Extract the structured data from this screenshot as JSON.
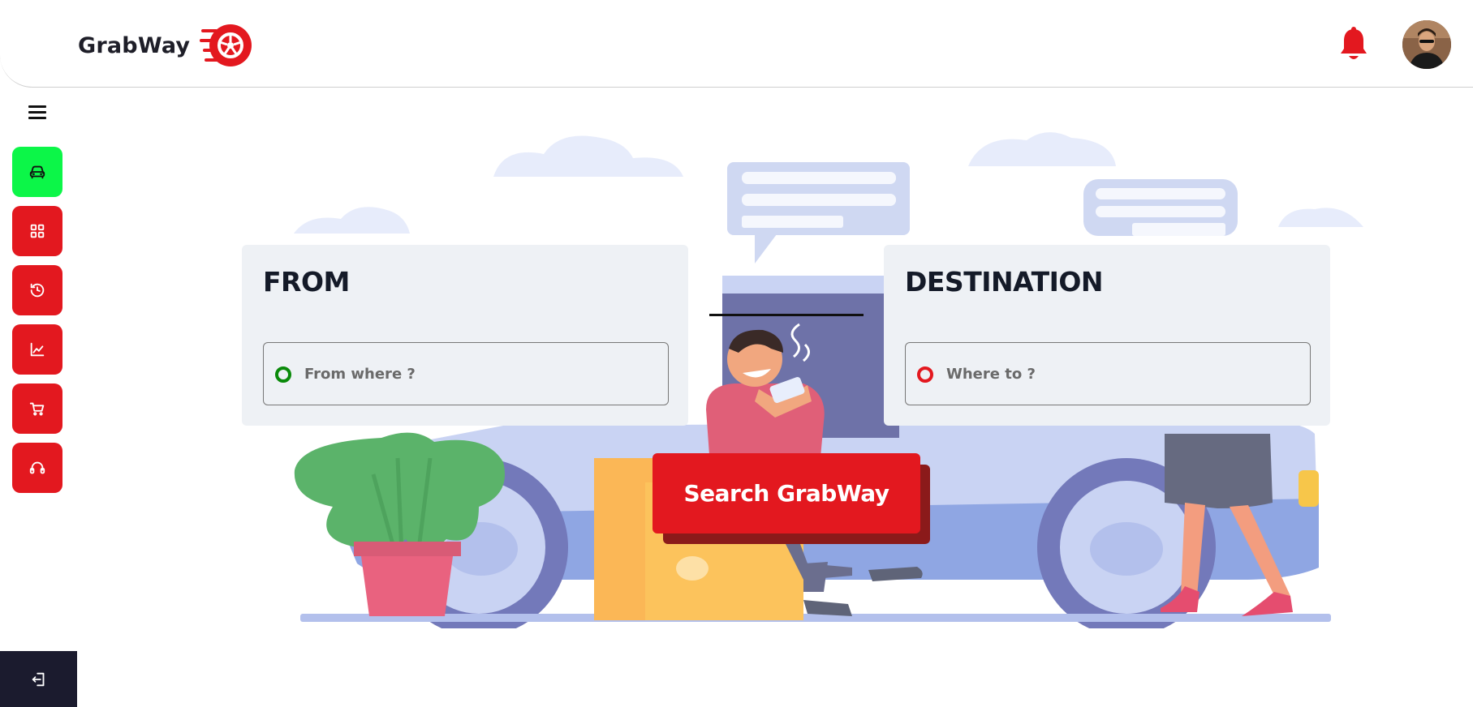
{
  "header": {
    "brand_name": "GrabWay",
    "logo_icon": "tire-logo-icon",
    "notification_icon": "bell-icon",
    "avatar_icon": "user-avatar"
  },
  "sidebar": {
    "menu_icon": "hamburger-menu-icon",
    "items": [
      {
        "icon": "car-icon",
        "active": true
      },
      {
        "icon": "dashboard-grid-icon",
        "active": false
      },
      {
        "icon": "history-icon",
        "active": false
      },
      {
        "icon": "chart-line-icon",
        "active": false
      },
      {
        "icon": "cart-icon",
        "active": false
      },
      {
        "icon": "headset-support-icon",
        "active": false
      }
    ],
    "logout_icon": "logout-icon"
  },
  "from_card": {
    "title": "FROM",
    "placeholder": "From where ?"
  },
  "destination_card": {
    "title": "DESTINATION",
    "placeholder": "Where to ?"
  },
  "search_button": {
    "label": "Search GrabWay"
  },
  "colors": {
    "accent_red": "#e3181f",
    "active_green": "#0cf648",
    "dark_navy": "#1b1b2e",
    "card_bg": "#eef1f5"
  }
}
